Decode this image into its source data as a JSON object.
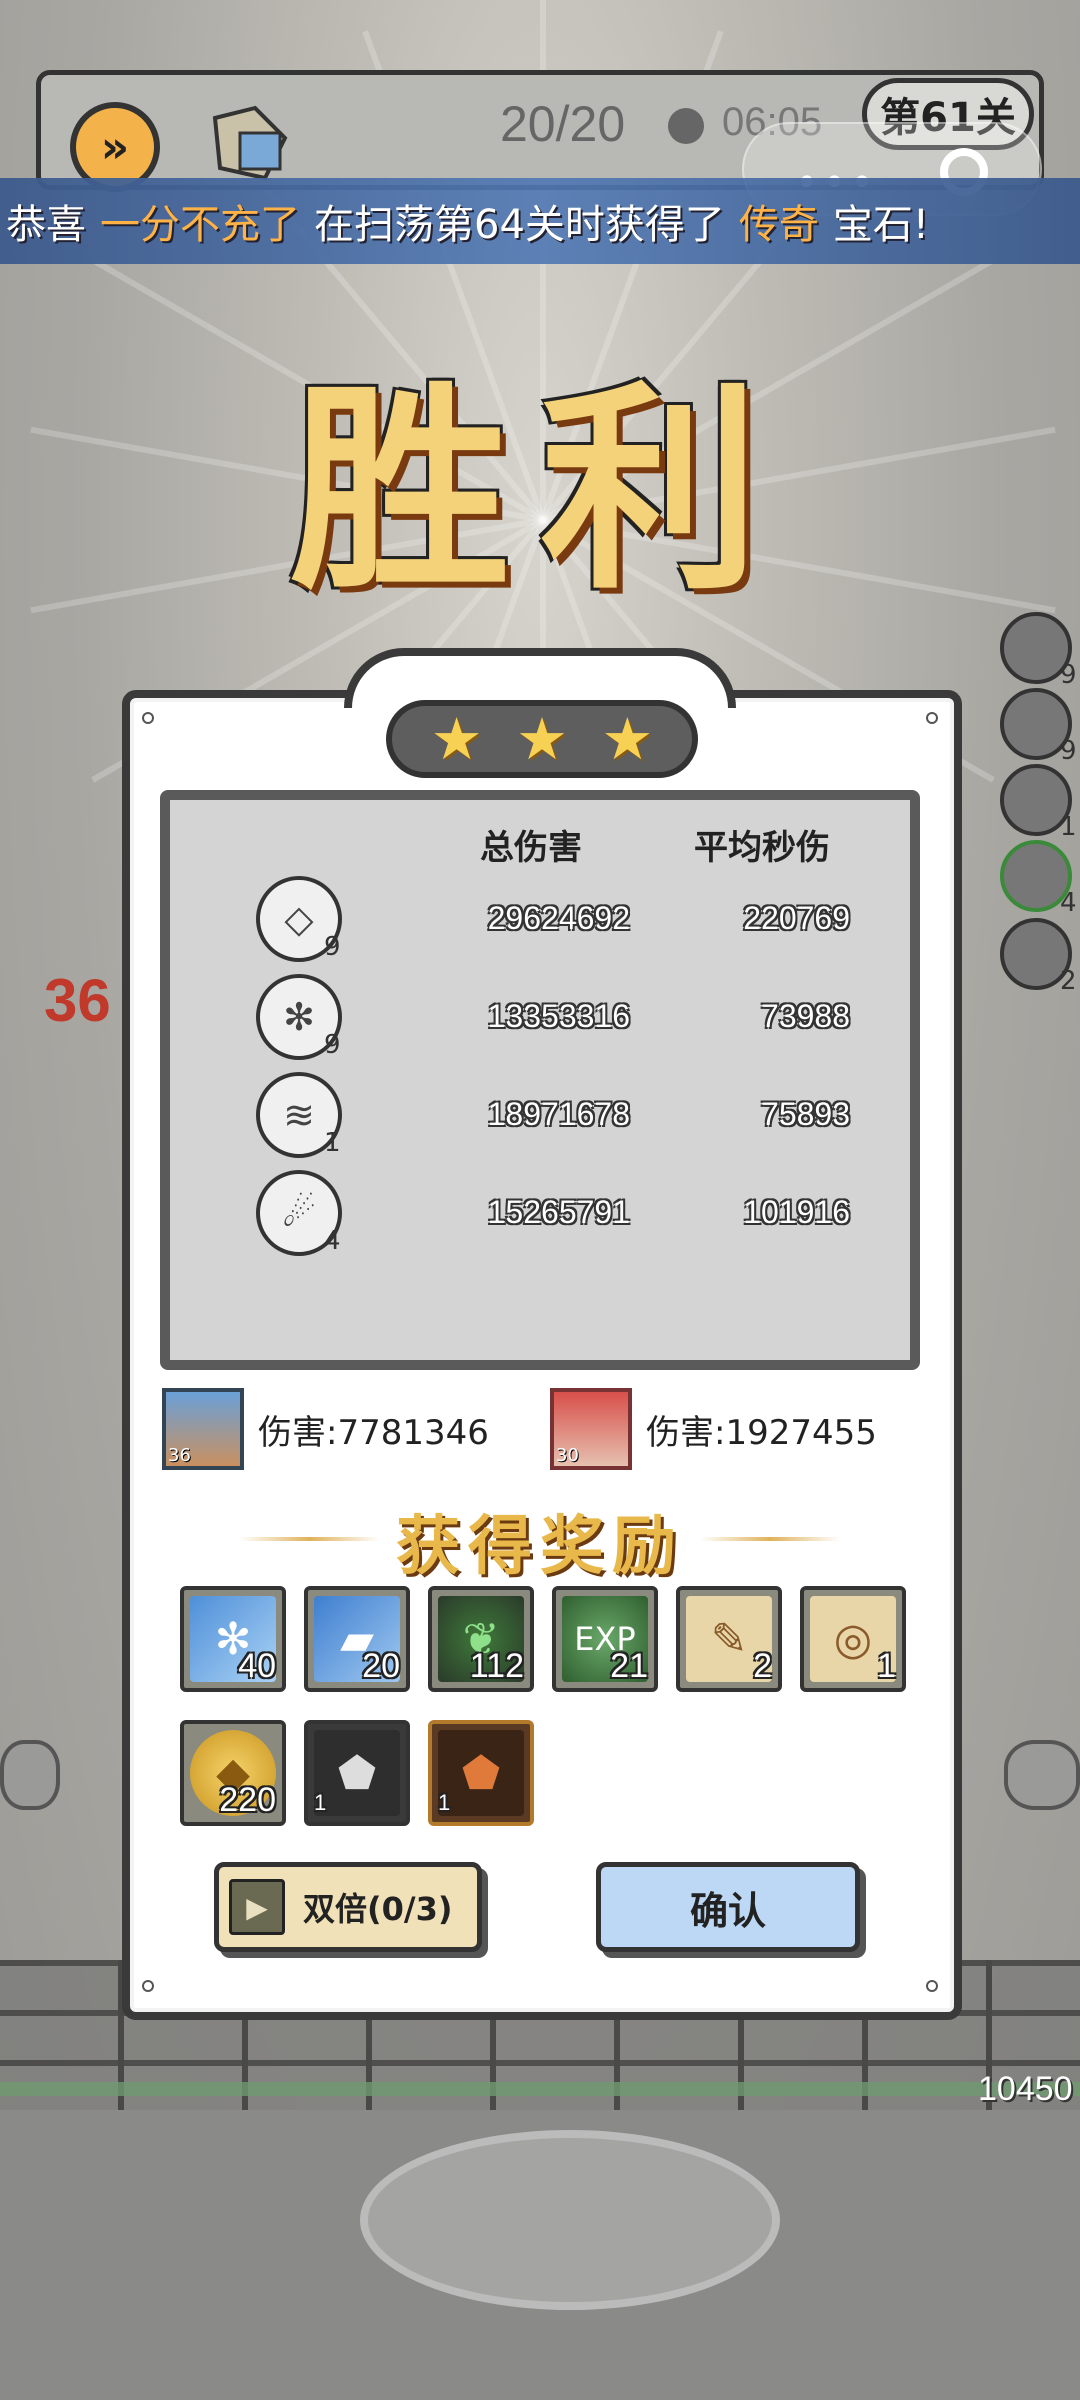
{
  "hud": {
    "fast_forward_icon": "fast-forward-icon",
    "energy": "20/20",
    "timer": "06:05",
    "level": "第61关",
    "menu_dots": "•••"
  },
  "banner": {
    "prefix": "恭喜",
    "player": "一分不充了",
    "middle": "在扫荡第64关时获得了",
    "rarity": "传奇",
    "suffix": "宝石!"
  },
  "title": "胜利",
  "stars": [
    "★",
    "★",
    "★"
  ],
  "stats": {
    "header_total": "总伤害",
    "header_avg": "平均秒伤",
    "rows": [
      {
        "icon": "crystal-chunk-skill-icon",
        "level": "9",
        "total": "29624692",
        "avg": "220769"
      },
      {
        "icon": "ice-shards-skill-icon",
        "level": "9",
        "total": "13353316",
        "avg": "73988"
      },
      {
        "icon": "tornado-skill-icon",
        "level": "1",
        "total": "18971678",
        "avg": "75893"
      },
      {
        "icon": "meteor-skill-icon",
        "level": "4",
        "total": "15265791",
        "avg": "101916"
      }
    ]
  },
  "heroes": [
    {
      "level": "36",
      "label": "伤害:7781346"
    },
    {
      "level": "30",
      "label": "伤害:1927455"
    }
  ],
  "reward_title": "获得奖励",
  "rewards": [
    {
      "icon": "ice-crystal-icon",
      "count": "40"
    },
    {
      "icon": "ice-block-icon",
      "count": "20"
    },
    {
      "icon": "green-leaf-emblem-icon",
      "count": "112"
    },
    {
      "icon": "exp-orb-icon",
      "count": "21",
      "label": "EXP"
    },
    {
      "icon": "scroll-boot-icon",
      "count": "2"
    },
    {
      "icon": "scroll-ring-icon",
      "count": "1"
    },
    {
      "icon": "gold-coin-icon",
      "count": "220"
    },
    {
      "icon": "silver-ore-icon",
      "count": "1"
    },
    {
      "icon": "copper-ore-icon",
      "count": "1"
    }
  ],
  "side": {
    "left_damage": "36",
    "boss_hp": "10450",
    "icon_levels": [
      "9",
      "9",
      "1",
      "4",
      "2"
    ]
  },
  "buttons": {
    "double": "双倍(0/3)",
    "confirm": "确认"
  },
  "colors": {
    "highlight": "#ffb347",
    "gold": "#f3d27a",
    "confirm_bg": "#bcd8f5",
    "double_bg": "#f1e1b8"
  }
}
